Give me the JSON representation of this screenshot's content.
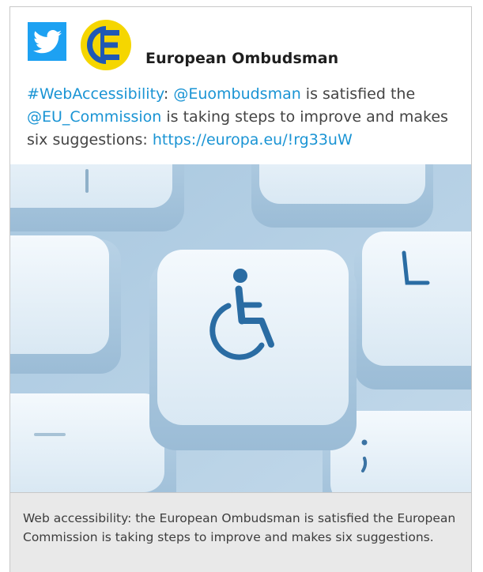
{
  "account": {
    "name": "European Ombudsman"
  },
  "tweet": {
    "hashtag": "#WebAccessibility",
    "colon": ":",
    "mention1": "@Euombudsman",
    "text1": " is satisfied the ",
    "mention2": "@EU_Commission",
    "text2": " is taking steps to improve and makes six suggestions: ",
    "url": "https://europa.eu/!rg33uW"
  },
  "media": {
    "description_icon": "wheelchair-accessibility-icon",
    "keys": [
      "L",
      ";"
    ]
  },
  "caption": {
    "text": "Web accessibility: the European Ombudsman is satisfied the European Commission is taking steps to improve and makes six suggestions."
  },
  "colors": {
    "twitter_blue": "#1da1f2",
    "eo_yellow": "#f5d600",
    "eo_blue": "#1f58b4",
    "link": "#1a94d4",
    "key_symbol": "#2a6ca3"
  }
}
